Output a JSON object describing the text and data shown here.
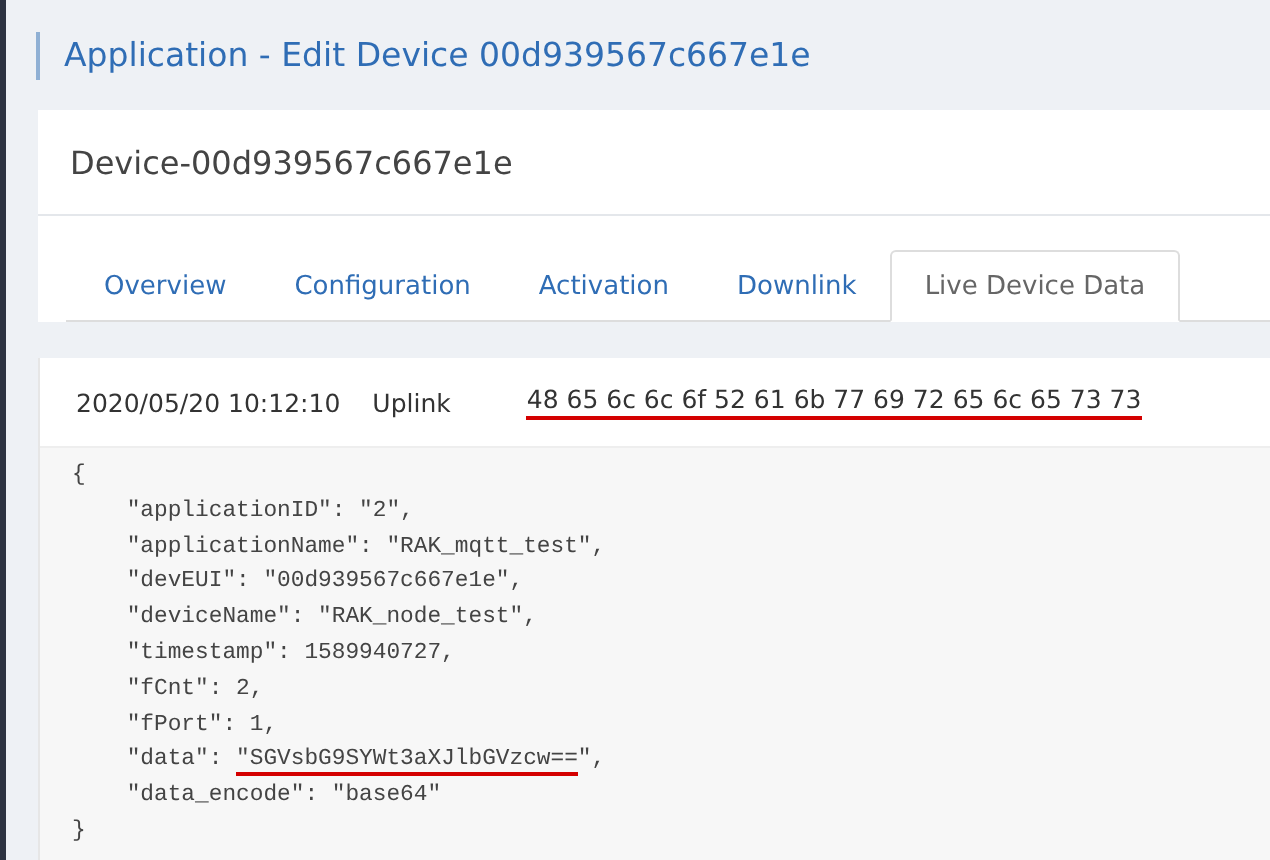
{
  "page_title": "Application - Edit Device 00d939567c667e1e",
  "device_title": "Device-00d939567c667e1e",
  "tabs": [
    {
      "label": "Overview",
      "selected": false
    },
    {
      "label": "Configuration",
      "selected": false
    },
    {
      "label": "Activation",
      "selected": false
    },
    {
      "label": "Downlink",
      "selected": false
    },
    {
      "label": "Live Device Data",
      "selected": true
    }
  ],
  "event": {
    "time": "2020/05/20 10:12:10",
    "type": "Uplink",
    "payload": "48 65 6c 6c 6f 52 61 6b 77 69 72 65 6c 65 73 73",
    "payload_underlined": true
  },
  "code_lines": [
    {
      "text": "{"
    },
    {
      "text": "    \"applicationID\": \"2\","
    },
    {
      "text": "    \"applicationName\": \"RAK_mqtt_test\","
    },
    {
      "text": "    \"devEUI\": \"00d939567c667e1e\","
    },
    {
      "text": "    \"deviceName\": \"RAK_node_test\","
    },
    {
      "text": "    \"timestamp\": 1589940727,"
    },
    {
      "text": "    \"fCnt\": 2,"
    },
    {
      "text": "    \"fPort\": 1,"
    },
    {
      "text": "    \"data\": ",
      "marked": "\"SGVsbG9SYWt3aXJlbGVzcw==",
      "after": "\","
    },
    {
      "text": "    \"data_encode\": \"base64\""
    },
    {
      "text": "}"
    }
  ]
}
